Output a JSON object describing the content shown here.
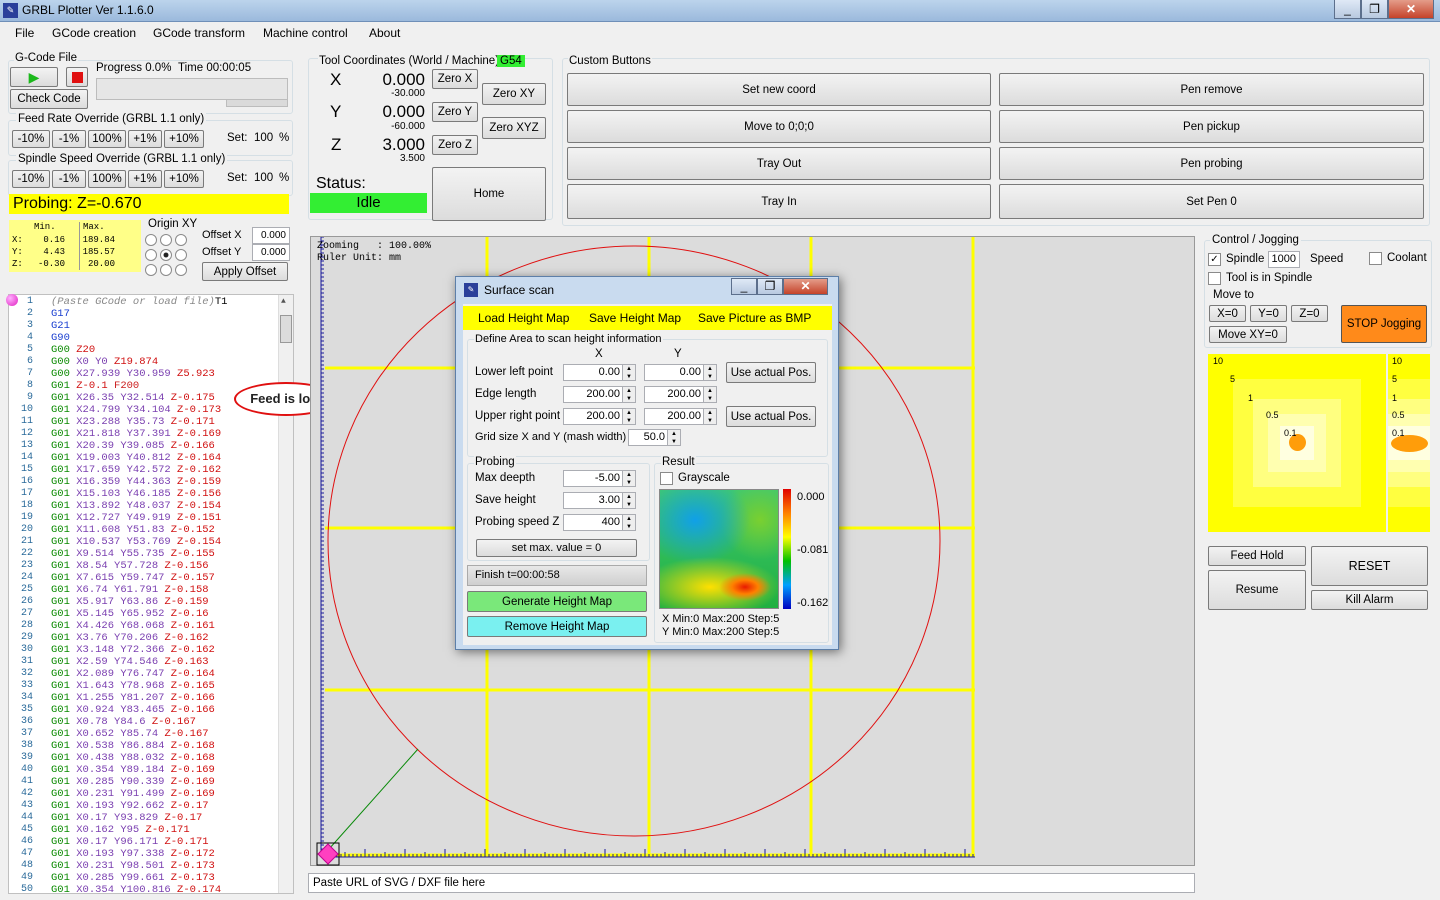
{
  "app": {
    "title": "GRBL Plotter Ver 1.1.6.0",
    "window_buttons": [
      "_",
      "❐",
      "✕"
    ]
  },
  "menu": [
    "File",
    "GCode creation",
    "GCode transform",
    "Machine control",
    "About"
  ],
  "gcode_file": {
    "group_title": "G-Code File",
    "progress_label": "Progress 0.0%",
    "time_label": "Time 00:00:05",
    "check_code": "Check Code",
    "progress": 0.0
  },
  "feed_override": {
    "title": "Feed Rate Override (GRBL 1.1 only)",
    "buttons": [
      "-10%",
      "-1%",
      "100%",
      "+1%",
      "+10%"
    ],
    "set_label": "Set:",
    "set_value": "100",
    "unit": "%"
  },
  "spindle_override": {
    "title": "Spindle Speed Override (GRBL 1.1 only)",
    "buttons": [
      "-10%",
      "-1%",
      "100%",
      "+1%",
      "+10%"
    ],
    "set_label": "Set:",
    "set_value": "100",
    "unit": "%"
  },
  "probing_banner": "Probing: Z=-0.670",
  "minmax": {
    "min_header": "Min.",
    "max_header": "Max.",
    "rows": [
      {
        "axis": "X:",
        "min": "0.16",
        "max": "189.84"
      },
      {
        "axis": "Y:",
        "min": "4.43",
        "max": "185.57"
      },
      {
        "axis": "Z:",
        "min": "-0.30",
        "max": "20.00"
      }
    ]
  },
  "origin": {
    "title": "Origin XY",
    "offset_x_label": "Offset X",
    "offset_x": "0.000",
    "offset_y_label": "Offset Y",
    "offset_y": "0.000",
    "apply": "Apply Offset"
  },
  "gcode_lines": [
    {
      "n": "1",
      "t": [
        [
          "cm",
          "(Paste GCode or load file)"
        ],
        [
          "",
          "T1"
        ]
      ]
    },
    {
      "n": "2",
      "t": [
        [
          "bl",
          "G17"
        ]
      ]
    },
    {
      "n": "3",
      "t": [
        [
          "bl",
          "G21"
        ]
      ]
    },
    {
      "n": "4",
      "t": [
        [
          "bl",
          "G90"
        ]
      ]
    },
    {
      "n": "5",
      "t": [
        [
          "g",
          "G00 "
        ],
        [
          "z",
          "Z20"
        ]
      ]
    },
    {
      "n": "6",
      "t": [
        [
          "g",
          "G00 "
        ],
        [
          "xy",
          "X0 Y0 "
        ],
        [
          "z",
          "Z19.874"
        ]
      ]
    },
    {
      "n": "7",
      "t": [
        [
          "g",
          "G00 "
        ],
        [
          "xy",
          "X27.939 Y30.959 "
        ],
        [
          "z",
          "Z5.923"
        ]
      ]
    },
    {
      "n": "8",
      "t": [
        [
          "g",
          "G01 "
        ],
        [
          "z",
          "Z-0.1 "
        ],
        [
          "f",
          "F200"
        ]
      ]
    },
    {
      "n": "9",
      "t": [
        [
          "g",
          "G01 "
        ],
        [
          "xy",
          "X26.35 Y32.514 "
        ],
        [
          "z",
          "Z-0.175"
        ]
      ]
    },
    {
      "n": "10",
      "t": [
        [
          "g",
          "G01 "
        ],
        [
          "xy",
          "X24.799 Y34.104 "
        ],
        [
          "z",
          "Z-0.173"
        ]
      ]
    },
    {
      "n": "11",
      "t": [
        [
          "g",
          "G01 "
        ],
        [
          "xy",
          "X23.288 Y35.73 "
        ],
        [
          "z",
          "Z-0.171"
        ]
      ]
    },
    {
      "n": "12",
      "t": [
        [
          "g",
          "G01 "
        ],
        [
          "xy",
          "X21.818 Y37.391 "
        ],
        [
          "z",
          "Z-0.169"
        ]
      ]
    },
    {
      "n": "13",
      "t": [
        [
          "g",
          "G01 "
        ],
        [
          "xy",
          "X20.39 Y39.085 "
        ],
        [
          "z",
          "Z-0.166"
        ]
      ]
    },
    {
      "n": "14",
      "t": [
        [
          "g",
          "G01 "
        ],
        [
          "xy",
          "X19.003 Y40.812 "
        ],
        [
          "z",
          "Z-0.164"
        ]
      ]
    },
    {
      "n": "15",
      "t": [
        [
          "g",
          "G01 "
        ],
        [
          "xy",
          "X17.659 Y42.572 "
        ],
        [
          "z",
          "Z-0.162"
        ]
      ]
    },
    {
      "n": "16",
      "t": [
        [
          "g",
          "G01 "
        ],
        [
          "xy",
          "X16.359 Y44.363 "
        ],
        [
          "z",
          "Z-0.159"
        ]
      ]
    },
    {
      "n": "17",
      "t": [
        [
          "g",
          "G01 "
        ],
        [
          "xy",
          "X15.103 Y46.185 "
        ],
        [
          "z",
          "Z-0.156"
        ]
      ]
    },
    {
      "n": "18",
      "t": [
        [
          "g",
          "G01 "
        ],
        [
          "xy",
          "X13.892 Y48.037 "
        ],
        [
          "z",
          "Z-0.154"
        ]
      ]
    },
    {
      "n": "19",
      "t": [
        [
          "g",
          "G01 "
        ],
        [
          "xy",
          "X12.727 Y49.919 "
        ],
        [
          "z",
          "Z-0.151"
        ]
      ]
    },
    {
      "n": "20",
      "t": [
        [
          "g",
          "G01 "
        ],
        [
          "xy",
          "X11.608 Y51.83 "
        ],
        [
          "z",
          "Z-0.152"
        ]
      ]
    },
    {
      "n": "21",
      "t": [
        [
          "g",
          "G01 "
        ],
        [
          "xy",
          "X10.537 Y53.769 "
        ],
        [
          "z",
          "Z-0.154"
        ]
      ]
    },
    {
      "n": "22",
      "t": [
        [
          "g",
          "G01 "
        ],
        [
          "xy",
          "X9.514 Y55.735 "
        ],
        [
          "z",
          "Z-0.155"
        ]
      ]
    },
    {
      "n": "23",
      "t": [
        [
          "g",
          "G01 "
        ],
        [
          "xy",
          "X8.54 Y57.728 "
        ],
        [
          "z",
          "Z-0.156"
        ]
      ]
    },
    {
      "n": "24",
      "t": [
        [
          "g",
          "G01 "
        ],
        [
          "xy",
          "X7.615 Y59.747 "
        ],
        [
          "z",
          "Z-0.157"
        ]
      ]
    },
    {
      "n": "25",
      "t": [
        [
          "g",
          "G01 "
        ],
        [
          "xy",
          "X6.74 Y61.791 "
        ],
        [
          "z",
          "Z-0.158"
        ]
      ]
    },
    {
      "n": "26",
      "t": [
        [
          "g",
          "G01 "
        ],
        [
          "xy",
          "X5.917 Y63.86 "
        ],
        [
          "z",
          "Z-0.159"
        ]
      ]
    },
    {
      "n": "27",
      "t": [
        [
          "g",
          "G01 "
        ],
        [
          "xy",
          "X5.145 Y65.952 "
        ],
        [
          "z",
          "Z-0.16"
        ]
      ]
    },
    {
      "n": "28",
      "t": [
        [
          "g",
          "G01 "
        ],
        [
          "xy",
          "X4.426 Y68.068 "
        ],
        [
          "z",
          "Z-0.161"
        ]
      ]
    },
    {
      "n": "29",
      "t": [
        [
          "g",
          "G01 "
        ],
        [
          "xy",
          "X3.76 Y70.206 "
        ],
        [
          "z",
          "Z-0.162"
        ]
      ]
    },
    {
      "n": "30",
      "t": [
        [
          "g",
          "G01 "
        ],
        [
          "xy",
          "X3.148 Y72.366 "
        ],
        [
          "z",
          "Z-0.162"
        ]
      ]
    },
    {
      "n": "31",
      "t": [
        [
          "g",
          "G01 "
        ],
        [
          "xy",
          "X2.59 Y74.546 "
        ],
        [
          "z",
          "Z-0.163"
        ]
      ]
    },
    {
      "n": "32",
      "t": [
        [
          "g",
          "G01 "
        ],
        [
          "xy",
          "X2.089 Y76.747 "
        ],
        [
          "z",
          "Z-0.164"
        ]
      ]
    },
    {
      "n": "33",
      "t": [
        [
          "g",
          "G01 "
        ],
        [
          "xy",
          "X1.643 Y78.968 "
        ],
        [
          "z",
          "Z-0.165"
        ]
      ]
    },
    {
      "n": "34",
      "t": [
        [
          "g",
          "G01 "
        ],
        [
          "xy",
          "X1.255 Y81.207 "
        ],
        [
          "z",
          "Z-0.166"
        ]
      ]
    },
    {
      "n": "35",
      "t": [
        [
          "g",
          "G01 "
        ],
        [
          "xy",
          "X0.924 Y83.465 "
        ],
        [
          "z",
          "Z-0.166"
        ]
      ]
    },
    {
      "n": "36",
      "t": [
        [
          "g",
          "G01 "
        ],
        [
          "xy",
          "X0.78 Y84.6 "
        ],
        [
          "z",
          "Z-0.167"
        ]
      ]
    },
    {
      "n": "37",
      "t": [
        [
          "g",
          "G01 "
        ],
        [
          "xy",
          "X0.652 Y85.74 "
        ],
        [
          "z",
          "Z-0.167"
        ]
      ]
    },
    {
      "n": "38",
      "t": [
        [
          "g",
          "G01 "
        ],
        [
          "xy",
          "X0.538 Y86.884 "
        ],
        [
          "z",
          "Z-0.168"
        ]
      ]
    },
    {
      "n": "39",
      "t": [
        [
          "g",
          "G01 "
        ],
        [
          "xy",
          "X0.438 Y88.032 "
        ],
        [
          "z",
          "Z-0.168"
        ]
      ]
    },
    {
      "n": "40",
      "t": [
        [
          "g",
          "G01 "
        ],
        [
          "xy",
          "X0.354 Y89.184 "
        ],
        [
          "z",
          "Z-0.169"
        ]
      ]
    },
    {
      "n": "41",
      "t": [
        [
          "g",
          "G01 "
        ],
        [
          "xy",
          "X0.285 Y90.339 "
        ],
        [
          "z",
          "Z-0.169"
        ]
      ]
    },
    {
      "n": "42",
      "t": [
        [
          "g",
          "G01 "
        ],
        [
          "xy",
          "X0.231 Y91.499 "
        ],
        [
          "z",
          "Z-0.169"
        ]
      ]
    },
    {
      "n": "43",
      "t": [
        [
          "g",
          "G01 "
        ],
        [
          "xy",
          "X0.193 Y92.662 "
        ],
        [
          "z",
          "Z-0.17"
        ]
      ]
    },
    {
      "n": "44",
      "t": [
        [
          "g",
          "G01 "
        ],
        [
          "xy",
          "X0.17 Y93.829 "
        ],
        [
          "z",
          "Z-0.17"
        ]
      ]
    },
    {
      "n": "45",
      "t": [
        [
          "g",
          "G01 "
        ],
        [
          "xy",
          "X0.162 Y95 "
        ],
        [
          "z",
          "Z-0.171"
        ]
      ]
    },
    {
      "n": "46",
      "t": [
        [
          "g",
          "G01 "
        ],
        [
          "xy",
          "X0.17 Y96.171 "
        ],
        [
          "z",
          "Z-0.171"
        ]
      ]
    },
    {
      "n": "47",
      "t": [
        [
          "g",
          "G01 "
        ],
        [
          "xy",
          "X0.193 Y97.338 "
        ],
        [
          "z",
          "Z-0.172"
        ]
      ]
    },
    {
      "n": "48",
      "t": [
        [
          "g",
          "G01 "
        ],
        [
          "xy",
          "X0.231 Y98.501 "
        ],
        [
          "z",
          "Z-0.173"
        ]
      ]
    },
    {
      "n": "49",
      "t": [
        [
          "g",
          "G01 "
        ],
        [
          "xy",
          "X0.285 Y99.661 "
        ],
        [
          "z",
          "Z-0.173"
        ]
      ]
    },
    {
      "n": "50",
      "t": [
        [
          "g",
          "G01 "
        ],
        [
          "xy",
          "X0.354 Y100.816 "
        ],
        [
          "z",
          "Z-0.174"
        ]
      ]
    }
  ],
  "annotation": "Feed is lost",
  "tool_coords": {
    "title": "Tool Coordinates (World / Machine)",
    "wcs": "G54",
    "x_label": "X",
    "x_world": "0.000",
    "x_machine": "-30.000",
    "y_label": "Y",
    "y_world": "0.000",
    "y_machine": "-60.000",
    "z_label": "Z",
    "z_world": "3.000",
    "z_machine": "3.500",
    "zero_x": "Zero X",
    "zero_y": "Zero Y",
    "zero_z": "Zero Z",
    "zero_xy": "Zero XY",
    "zero_xyz": "Zero XYZ",
    "status_label": "Status:",
    "status": "Idle",
    "home": "Home"
  },
  "custom_buttons": {
    "title": "Custom Buttons",
    "left": [
      "Set new coord",
      "Move to 0;0;0",
      "Tray Out",
      "Tray In"
    ],
    "right": [
      "Pen remove",
      "Pen pickup",
      "Pen probing",
      "Set Pen 0"
    ]
  },
  "canvas": {
    "zoom_text": "Zooming   : 100.00%",
    "ruler_text": "Ruler Unit: mm",
    "url_placeholder": "Paste URL of SVG / DXF file here"
  },
  "dialog": {
    "title": "Surface scan",
    "menu": [
      "Load Height Map",
      "Save Height Map",
      "Save Picture as BMP"
    ],
    "define_title": "Define Area to scan height information",
    "col_x": "X",
    "col_y": "Y",
    "lower_left_label": "Lower left point",
    "lower_left_x": "0.00",
    "lower_left_y": "0.00",
    "edge_label": "Edge length",
    "edge_x": "200.00",
    "edge_y": "200.00",
    "upper_right_label": "Upper right point",
    "upper_right_x": "200.00",
    "upper_right_y": "200.00",
    "use_actual": "Use actual Pos.",
    "grid_label": "Grid size X and Y (mash width)",
    "grid_value": "50.0",
    "probing_title": "Probing",
    "max_deep_label": "Max deepth",
    "max_deep": "-5.00",
    "save_height_label": "Save height",
    "save_height": "3.00",
    "probe_speed_label": "Probing speed Z",
    "probe_speed": "400",
    "set_max": "set max. value = 0",
    "finish": "Finish t=00:00:58",
    "generate": "Generate Height Map",
    "remove": "Remove Height Map",
    "result_title": "Result",
    "grayscale": "Grayscale",
    "scale_max": "0.000",
    "scale_mid": "-0.081",
    "scale_min": "-0.162",
    "x_info": "X Min:0 Max:200 Step:5",
    "y_info": "Y Min:0 Max:200 Step:5"
  },
  "control": {
    "title": "Control / Jogging",
    "spindle": "Spindle",
    "spindle_speed": "1000",
    "speed_label": "Speed",
    "coolant": "Coolant",
    "tool_in_spindle": "Tool is in Spindle",
    "move_to": "Move to",
    "x0": "X=0",
    "y0": "Y=0",
    "z0": "Z=0",
    "move_xy0": "Move XY=0",
    "stop_jogging": "STOP Jogging",
    "jog_labels": [
      "10",
      "5",
      "1",
      "0.5",
      "0.1"
    ],
    "jogz_labels": [
      "10",
      "5",
      "1",
      "0.5",
      "0.1"
    ],
    "feed_hold": "Feed Hold",
    "resume": "Resume",
    "reset": "RESET",
    "kill_alarm": "Kill Alarm"
  },
  "colors": {
    "yellow": "#ffff00",
    "idle_green": "#33ee33",
    "stop_orange": "#ff8a1a",
    "generate_green": "#7ae87a",
    "remove_cyan": "#7af0f0"
  }
}
